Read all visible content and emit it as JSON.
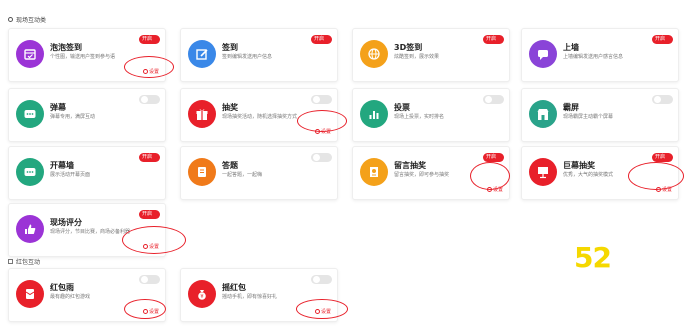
{
  "sections": {
    "interactive": "现场互动类",
    "red_packet": "红包互动"
  },
  "toggle_on_label": "开启",
  "settings_label": "设置",
  "cards": [
    {
      "title": "泡泡签到",
      "desc": "个性图，输送用户签到参与语",
      "on": true,
      "settings": true,
      "icon": "calendar-check-icon",
      "color": "#9b34d6"
    },
    {
      "title": "签到",
      "desc": "签到编辑发送用户信息",
      "on": true,
      "settings": false,
      "icon": "edit-icon",
      "color": "#3a88e8"
    },
    {
      "title": "3D签到",
      "desc": "炫酷签到，展示效果",
      "on": true,
      "settings": false,
      "icon": "globe-icon",
      "color": "#f4a11a"
    },
    {
      "title": "上墙",
      "desc": "上墙编辑发送用户感言信息",
      "on": true,
      "settings": false,
      "icon": "chat-bubble-icon",
      "color": "#8a44d8"
    },
    {
      "title": "弹幕",
      "desc": "弹幕专用，满屏互动",
      "on": false,
      "settings": false,
      "icon": "message-dots-icon",
      "color": "#23a77f"
    },
    {
      "title": "抽奖",
      "desc": "现场抽奖活动，随机选择抽奖方式",
      "on": false,
      "settings": true,
      "icon": "gift-icon",
      "color": "#e8202a"
    },
    {
      "title": "投票",
      "desc": "现场上投票，实时排名",
      "on": false,
      "settings": false,
      "icon": "bar-chart-icon",
      "color": "#23a77f"
    },
    {
      "title": "霸屏",
      "desc": "现场霸屏主动霸个屏幕",
      "on": false,
      "settings": false,
      "icon": "store-icon",
      "color": "#2aa38a"
    },
    {
      "title": "开幕墙",
      "desc": "展示活动开幕页面",
      "on": true,
      "settings": false,
      "icon": "message-dots-icon",
      "color": "#23a77f"
    },
    {
      "title": "答题",
      "desc": "一起答题，一起嗨",
      "on": false,
      "settings": false,
      "icon": "document-icon",
      "color": "#f07a1a"
    },
    {
      "title": "留言抽奖",
      "desc": "留言抽奖，即可参与抽奖",
      "on": true,
      "settings": true,
      "icon": "trophy-doc-icon",
      "color": "#f4a11a"
    },
    {
      "title": "巨幕抽奖",
      "desc": "优秀，大气的抽奖模式",
      "on": true,
      "settings": true,
      "icon": "presentation-icon",
      "color": "#e8202a"
    },
    {
      "title": "现场评分",
      "desc": "现场评分，节目比赛，商场必备利器",
      "on": true,
      "settings": true,
      "icon": "thumbs-up-icon",
      "color": "#9b34d6"
    },
    {
      "title": "红包雨",
      "desc": "最有趣的红包游戏",
      "on": false,
      "settings": true,
      "icon": "red-envelope-icon",
      "color": "#e8202a"
    },
    {
      "title": "摇红包",
      "desc": "摇动手机，即有惊喜好礼",
      "on": false,
      "settings": true,
      "icon": "money-bag-icon",
      "color": "#e8202a"
    }
  ],
  "logo_text": "52"
}
